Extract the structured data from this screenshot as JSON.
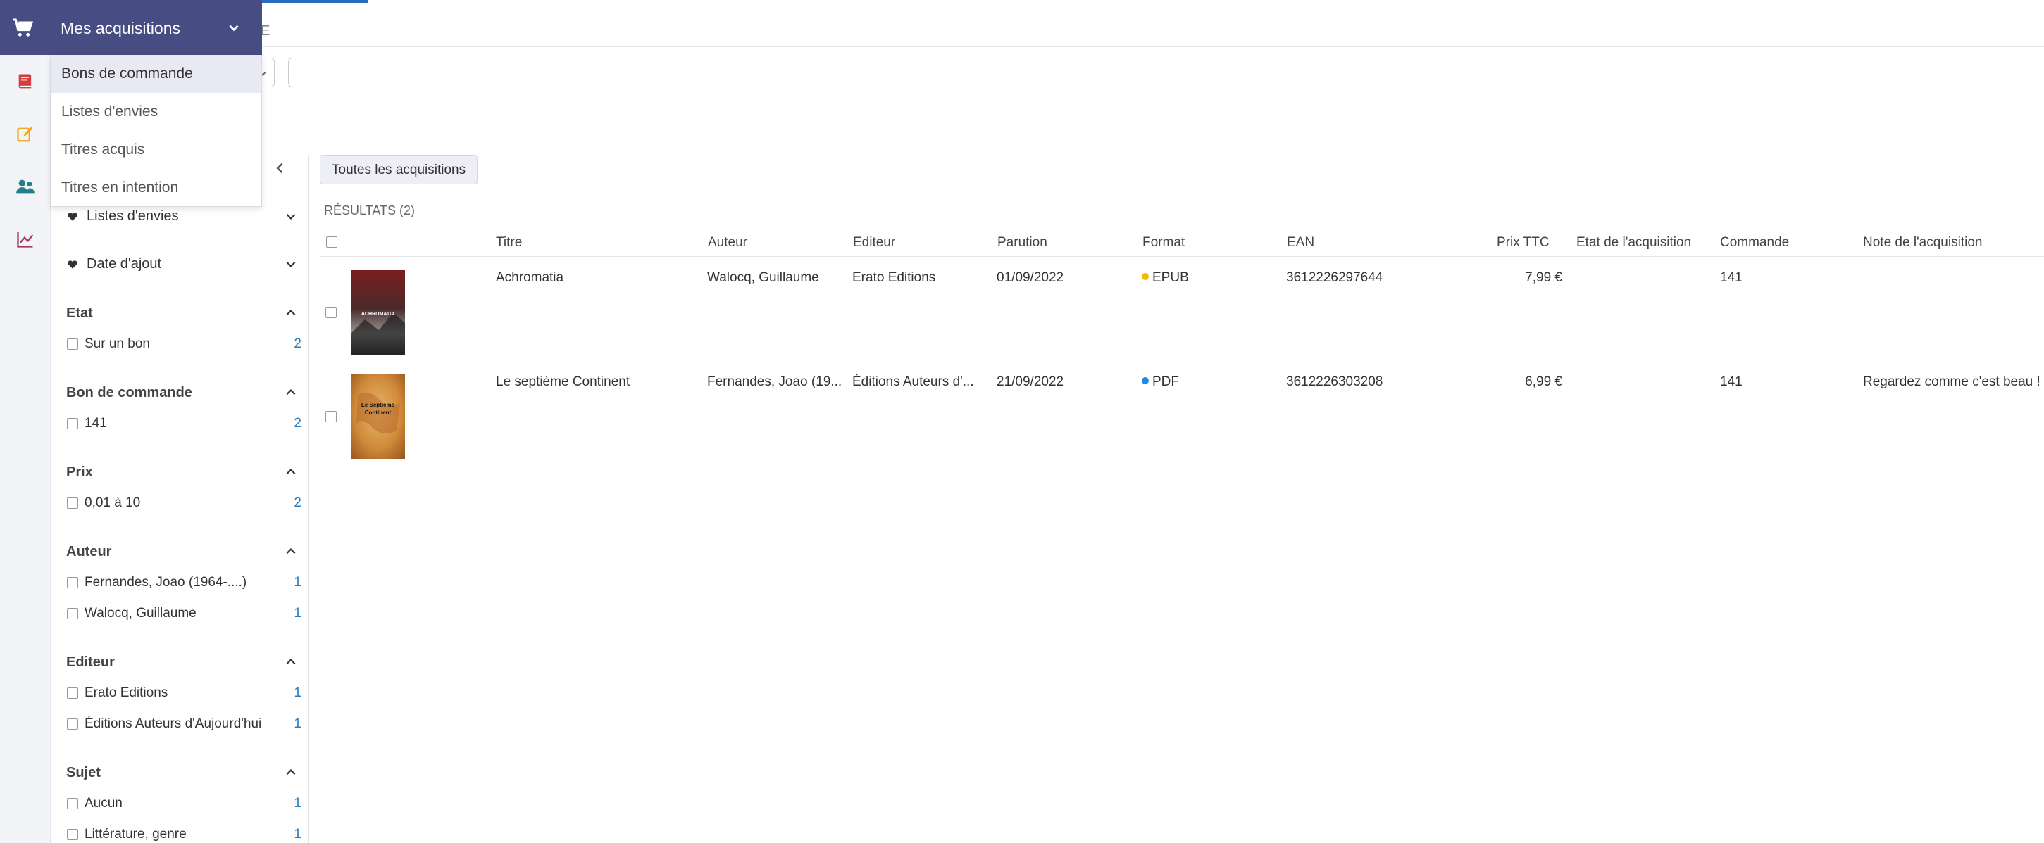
{
  "header": {
    "dropdown_title": "Mes acquisitions",
    "tab_suffix": "E"
  },
  "menu": {
    "items": [
      "Bons de commande",
      "Listes d'envies",
      "Titres acquis",
      "Titres en intention"
    ]
  },
  "rail": {
    "icons": [
      "cart-icon",
      "book-icon",
      "edit-icon",
      "users-icon",
      "chart-icon"
    ],
    "colors": {
      "cart": "#ffffff",
      "book": "#d23f3f",
      "edit": "#f5a623",
      "users": "#1f7f8c",
      "chart": "#a33a5a"
    }
  },
  "colors": {
    "menu_bg": "#474d82",
    "accent": "#2a6dbe",
    "count": "#2a7fbf",
    "epub_dot": "#f5b800",
    "pdf_dot": "#1e88e5"
  },
  "facets": {
    "wishlist": "Listes d'envies",
    "date_added": "Date d'ajout",
    "etat": {
      "title": "Etat",
      "options": [
        {
          "label": "Sur un bon",
          "count": "2"
        }
      ]
    },
    "bon": {
      "title": "Bon de commande",
      "options": [
        {
          "label": "141",
          "count": "2"
        }
      ]
    },
    "prix": {
      "title": "Prix",
      "options": [
        {
          "label": "0,01 à 10",
          "count": "2"
        }
      ]
    },
    "auteur": {
      "title": "Auteur",
      "options": [
        {
          "label": "Fernandes, Joao (1964-....)",
          "count": "1"
        },
        {
          "label": "Walocq, Guillaume",
          "count": "1"
        }
      ]
    },
    "editeur": {
      "title": "Editeur",
      "options": [
        {
          "label": "Erato Editions",
          "count": "1"
        },
        {
          "label": "Éditions Auteurs d'Aujourd'hui",
          "count": "1"
        }
      ]
    },
    "sujet": {
      "title": "Sujet",
      "options": [
        {
          "label": "Aucun",
          "count": "1"
        },
        {
          "label": "Littérature, genre",
          "count": "1"
        }
      ]
    }
  },
  "main": {
    "all_button": "Toutes les acquisitions",
    "results_label": "RÉSULTATS (2)",
    "columns": [
      "Titre",
      "Auteur",
      "Editeur",
      "Parution",
      "Format",
      "EAN",
      "Prix TTC",
      "Etat de l'acquisition",
      "Commande",
      "Note de l'acquisition"
    ],
    "rows": [
      {
        "titre": "Achromatia",
        "auteur": "Walocq, Guillaume",
        "editeur": "Erato Editions",
        "parution": "01/09/2022",
        "format": "EPUB",
        "ean": "3612226297644",
        "prix": "7,99 €",
        "etat": "",
        "commande": "141",
        "note": "",
        "cover_text": "ACHROMATIA"
      },
      {
        "titre": "Le septième Continent",
        "auteur": "Fernandes, Joao (19...",
        "editeur": "Éditions Auteurs d'...",
        "parution": "21/09/2022",
        "format": "PDF",
        "ean": "3612226303208",
        "prix": "6,99 €",
        "etat": "",
        "commande": "141",
        "note": "Regardez comme c'est beau !",
        "cover_text": "Le Septième Continent"
      }
    ]
  }
}
